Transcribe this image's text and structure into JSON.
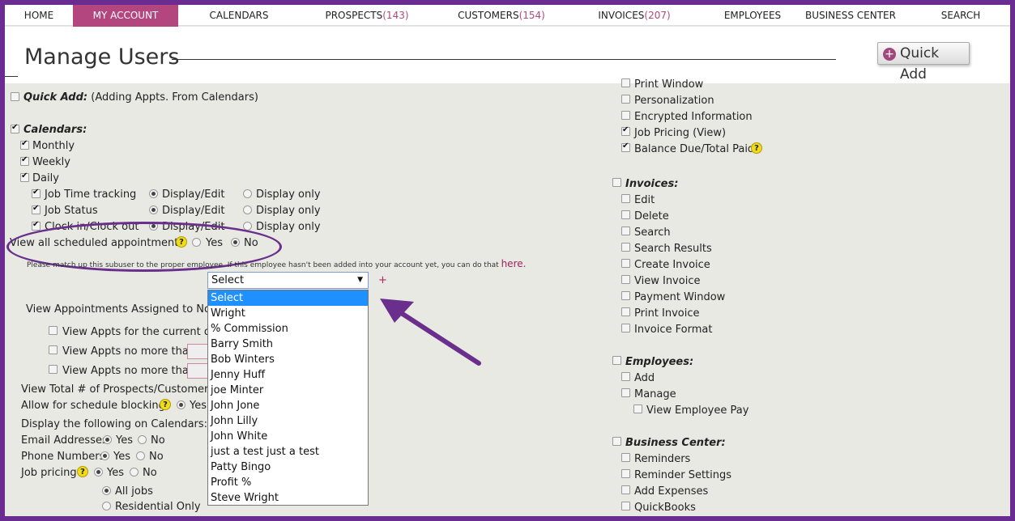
{
  "nav": {
    "home": "HOME",
    "my_account": "MY ACCOUNT",
    "calendars": "CALENDARS",
    "prospects": "PROSPECTS",
    "prospects_count": "(143)",
    "customers": "CUSTOMERS",
    "customers_count": "(154)",
    "invoices": "INVOICES",
    "invoices_count": "(207)",
    "employees": "EMPLOYEES",
    "business_center": "BUSINESS CENTER",
    "search": "SEARCH"
  },
  "header": {
    "title": "Manage Users",
    "quick_add": "Quick Add"
  },
  "left": {
    "quick_add_label": "Quick Add:",
    "quick_add_note": "(Adding Appts. From Calendars)",
    "calendars_label": "Calendars:",
    "monthly": "Monthly",
    "weekly": "Weekly",
    "daily": "Daily",
    "job_time_tracking": "Job Time tracking",
    "job_status": "Job Status",
    "clock": "Clock in/Clock out",
    "display_edit": "Display/Edit",
    "display_only": "Display only",
    "view_all": "View all scheduled appointments",
    "yes": "Yes",
    "no": "No",
    "match_note": "Please match up this subuser to the proper employee. If this employee hasn't been added into your account yet, you can do that",
    "here": "here.",
    "plus": "+",
    "view_assigned": "View Appointments Assigned to No O",
    "view_current": "View Appts for the current dat",
    "view_no_more": "View Appts no more than",
    "view_total": "View Total # of Prospects/Customers",
    "allow_blocking": "Allow for schedule blocking",
    "yes_trunc": "Yes",
    "display_following": "Display the following on Calendars:",
    "email": "Email Addresses",
    "phone": "Phone Numbers",
    "job_pricing": "Job pricing",
    "all_jobs": "All jobs",
    "residential_only": "Residential Only"
  },
  "dropdown": {
    "selected": "Select",
    "options": [
      "Select",
      "Wright",
      "% Commission",
      "Barry Smith",
      "Bob Winters",
      "Jenny Huff",
      "joe Minter",
      "John Jone",
      "John Lilly",
      "John White",
      "just a test just a test",
      "Patty Bingo",
      "Profit %",
      "Steve Wright"
    ]
  },
  "right": {
    "print_window": "Print Window",
    "personalization": "Personalization",
    "encrypted": "Encrypted Information",
    "job_pricing_view": "Job Pricing (View)",
    "balance_due": "Balance Due/Total Paid",
    "invoices_label": "Invoices:",
    "edit": "Edit",
    "delete": "Delete",
    "search": "Search",
    "search_results": "Search Results",
    "create_invoice": "Create Invoice",
    "view_invoice": "View Invoice",
    "payment_window": "Payment Window",
    "print_invoice": "Print Invoice",
    "invoice_format": "Invoice Format",
    "employees_label": "Employees:",
    "add": "Add",
    "manage": "Manage",
    "view_employee_pay": "View Employee Pay",
    "business_center_label": "Business Center:",
    "reminders": "Reminders",
    "reminder_settings": "Reminder Settings",
    "add_expenses": "Add Expenses",
    "quickbooks": "QuickBooks"
  },
  "colors": {
    "frame": "#6b2c91",
    "active_tab": "#b3467f",
    "accent": "#b04a7e",
    "highlight": "#1e90ff"
  }
}
